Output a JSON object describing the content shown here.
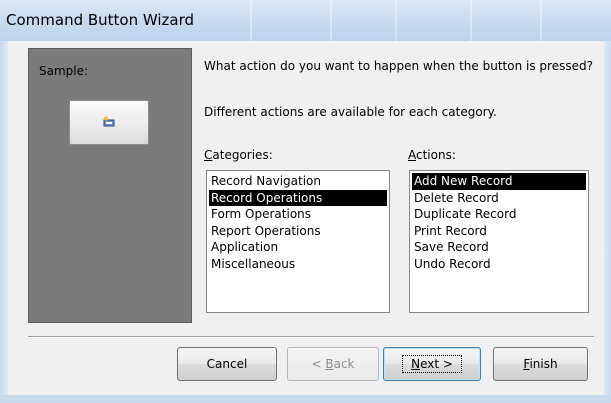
{
  "window": {
    "title": "Command Button Wizard"
  },
  "sample": {
    "label": "Sample:",
    "button_icon": "new-record-icon"
  },
  "prompt": {
    "question": "What action do you want to happen when the button is pressed?",
    "hint": "Different actions are available for each category."
  },
  "categories": {
    "label_accel": "C",
    "label_rest": "ategories:",
    "items": [
      {
        "label": "Record Navigation",
        "selected": false
      },
      {
        "label": "Record Operations",
        "selected": true
      },
      {
        "label": "Form Operations",
        "selected": false
      },
      {
        "label": "Report Operations",
        "selected": false
      },
      {
        "label": "Application",
        "selected": false
      },
      {
        "label": "Miscellaneous",
        "selected": false
      }
    ]
  },
  "actions": {
    "label_accel": "A",
    "label_rest": "ctions:",
    "items": [
      {
        "label": "Add New Record",
        "selected": true
      },
      {
        "label": "Delete Record",
        "selected": false
      },
      {
        "label": "Duplicate Record",
        "selected": false
      },
      {
        "label": "Print Record",
        "selected": false
      },
      {
        "label": "Save Record",
        "selected": false
      },
      {
        "label": "Undo Record",
        "selected": false
      }
    ]
  },
  "buttons": {
    "cancel": "Cancel",
    "back_prefix": "< ",
    "back_accel": "B",
    "back_rest": "ack",
    "next_accel": "N",
    "next_rest": "ext >",
    "finish_accel": "F",
    "finish_rest": "inish"
  },
  "colors": {
    "selection_bg": "#000000",
    "sample_panel": "#7b7b7b",
    "default_button_border": "#3c7fb1"
  }
}
